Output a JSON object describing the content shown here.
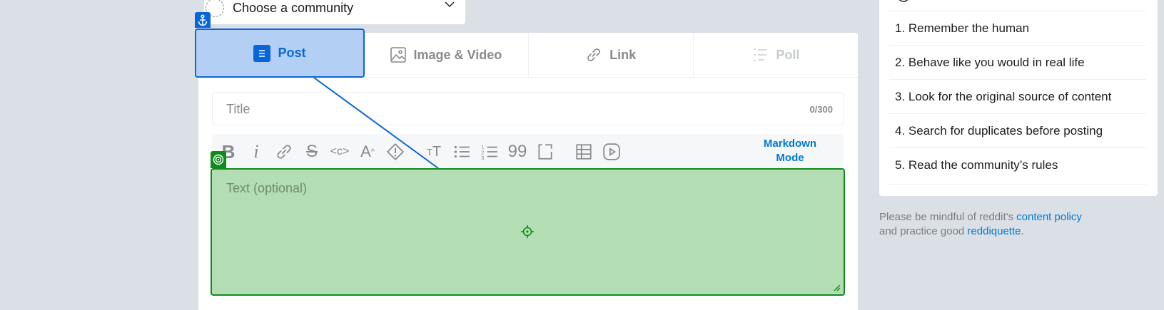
{
  "community_selector": {
    "label": "Choose a community"
  },
  "tabs": [
    {
      "label": "Post",
      "icon": "post-icon"
    },
    {
      "label": "Image & Video",
      "icon": "image-icon"
    },
    {
      "label": "Link",
      "icon": "link-icon"
    },
    {
      "label": "Poll",
      "icon": "poll-icon"
    }
  ],
  "title_field": {
    "placeholder": "Title",
    "count": "0/300"
  },
  "toolbar": {
    "icons": [
      "bold-icon",
      "italic-icon",
      "link-icon",
      "strikethrough-icon",
      "inline-code-icon",
      "superscript-icon",
      "spoiler-icon",
      "heading-icon",
      "bulleted-list-icon",
      "numbered-list-icon",
      "quote-block-icon",
      "code-block-icon",
      "table-icon",
      "embed-media-icon"
    ],
    "markdown_line1": "Markdown",
    "markdown_line2": "Mode"
  },
  "text_field": {
    "placeholder": "Text (optional)"
  },
  "rules": [
    "1. Remember the human",
    "2. Behave like you would in real life",
    "3. Look for the original source of content",
    "4. Search for duplicates before posting",
    "5. Read the community’s rules"
  ],
  "policy": {
    "pre": "Please be mindful of reddit's ",
    "link1": "content policy",
    "mid": "and practice good ",
    "link2": "reddiquette",
    "post": "."
  },
  "colors": {
    "accent": "#0079d3",
    "highlight_blue": "#0a66d8",
    "highlight_green": "#118a1c",
    "background": "#dae0e6"
  }
}
